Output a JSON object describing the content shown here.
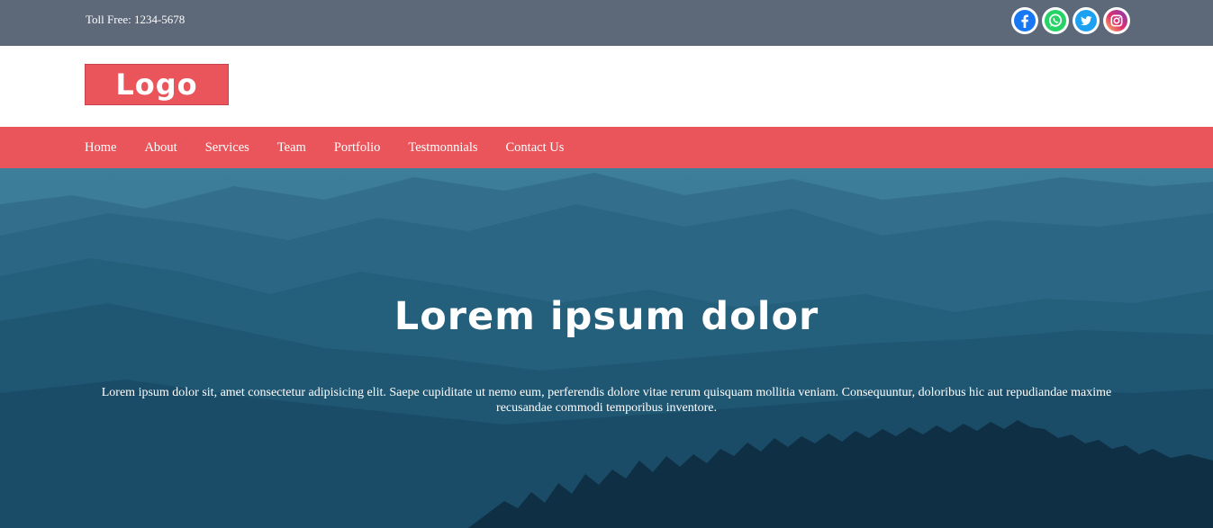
{
  "topbar": {
    "toll_free": "Toll Free: 1234-5678",
    "social": [
      {
        "name": "facebook-icon",
        "color": "#1877f2"
      },
      {
        "name": "whatsapp-icon",
        "color": "#25d366"
      },
      {
        "name": "twitter-icon",
        "color": "#1da1f2"
      },
      {
        "name": "instagram-icon",
        "color": "#c13584"
      }
    ]
  },
  "logo": {
    "text": "Logo",
    "color": "#e9555a"
  },
  "nav": {
    "color": "#e9555a",
    "items": [
      "Home",
      "About",
      "Services",
      "Team",
      "Portfolio",
      "Testmonnials",
      "Contact Us"
    ]
  },
  "hero": {
    "title": "Lorem ipsum dolor",
    "text": "Lorem ipsum dolor sit, amet consectetur adipisicing elit. Saepe cupiditate ut nemo eum, perferendis dolore vitae rerum quisquam mollitia veniam. Consequuntur, doloribus hic aut repudiandae maxime recusandae commodi temporibus inventore."
  }
}
